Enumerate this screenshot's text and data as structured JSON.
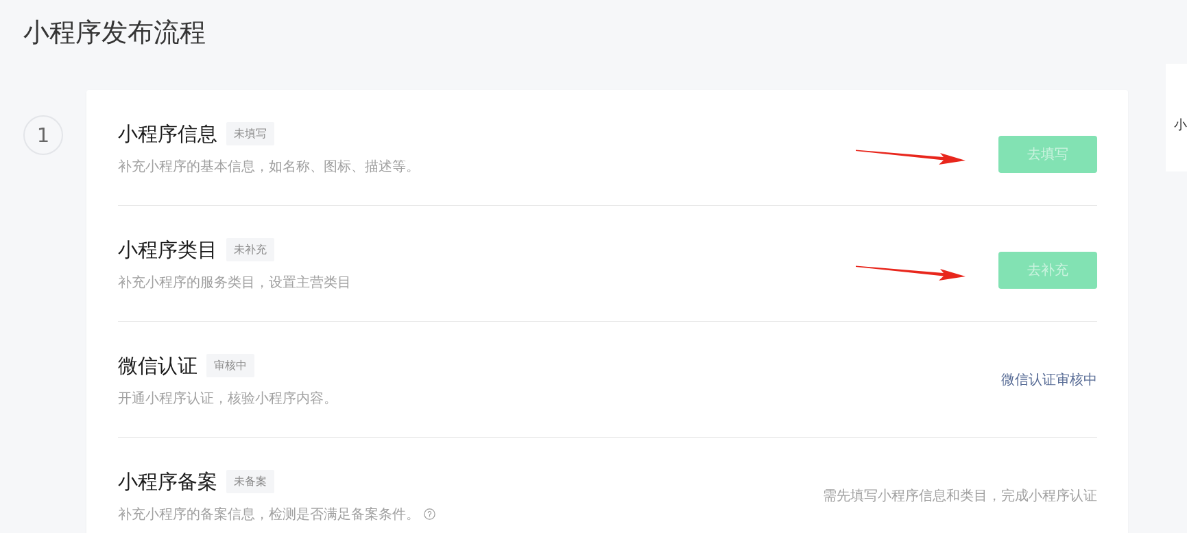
{
  "page": {
    "title": "小程序发布流程"
  },
  "step": {
    "number": "1"
  },
  "tasks": [
    {
      "title": "小程序信息",
      "status": "未填写",
      "description": "补充小程序的基本信息，如名称、图标、描述等。",
      "help_icon": false,
      "annotation_arrow": true,
      "action": {
        "kind": "button",
        "label": "去填写",
        "disabled": true
      }
    },
    {
      "title": "小程序类目",
      "status": "未补充",
      "description": "补充小程序的服务类目，设置主营类目",
      "help_icon": false,
      "annotation_arrow": true,
      "action": {
        "kind": "button",
        "label": "去补充",
        "disabled": true
      }
    },
    {
      "title": "微信认证",
      "status": "审核中",
      "description": "开通小程序认证，核验小程序内容。",
      "help_icon": false,
      "annotation_arrow": false,
      "action": {
        "kind": "status",
        "text": "微信认证审核中"
      }
    },
    {
      "title": "小程序备案",
      "status": "未备案",
      "description": "补充小程序的备案信息，检测是否满足备案条件。",
      "help_icon": true,
      "annotation_arrow": false,
      "action": {
        "kind": "hint",
        "text": "需先填写小程序信息和类目，完成小程序认证"
      }
    }
  ],
  "side_panel": {
    "text": "小"
  }
}
